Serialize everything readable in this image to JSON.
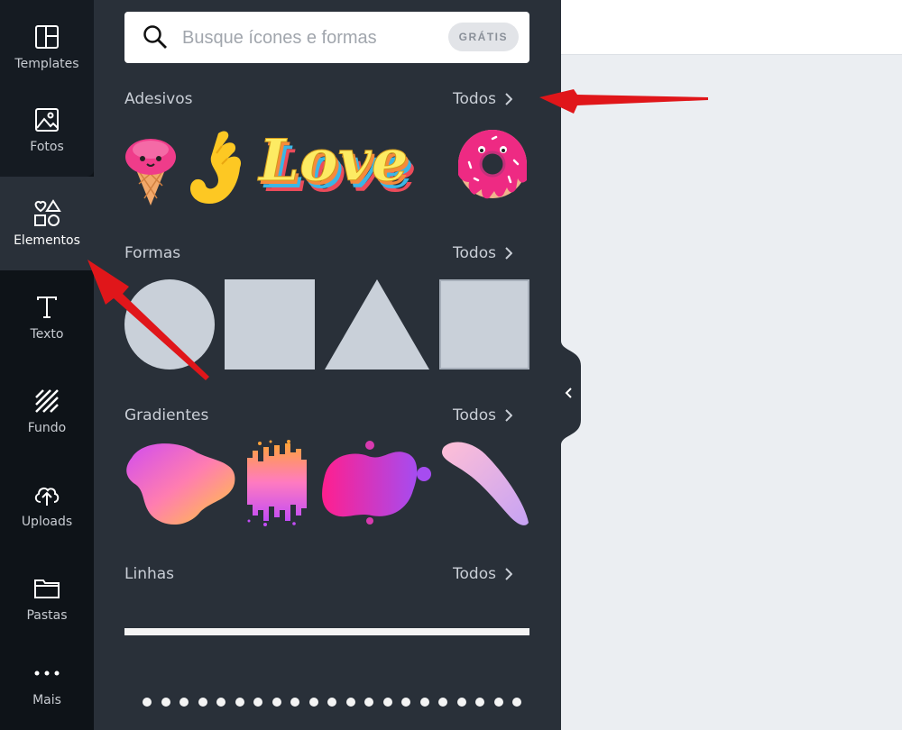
{
  "sidebar": {
    "items": [
      {
        "label": "Templates",
        "icon": "templates-icon"
      },
      {
        "label": "Fotos",
        "icon": "photos-icon"
      },
      {
        "label": "Elementos",
        "icon": "elements-icon",
        "active": true
      },
      {
        "label": "Texto",
        "icon": "text-icon"
      },
      {
        "label": "Fundo",
        "icon": "background-icon"
      },
      {
        "label": "Uploads",
        "icon": "upload-icon"
      },
      {
        "label": "Pastas",
        "icon": "folder-icon"
      },
      {
        "label": "Mais",
        "icon": "more-icon"
      }
    ]
  },
  "search": {
    "placeholder": "Busque ícones e formas",
    "badge": "GRÁTIS"
  },
  "sections": {
    "adesivos": {
      "title": "Adesivos",
      "all": "Todos"
    },
    "formas": {
      "title": "Formas",
      "all": "Todos"
    },
    "gradientes": {
      "title": "Gradientes",
      "all": "Todos"
    },
    "linhas": {
      "title": "Linhas",
      "all": "Todos"
    }
  },
  "stickers": {
    "love_text": "Love"
  },
  "colors": {
    "sidebar_bg": "#0e1318",
    "panel_bg": "#293039",
    "canvas_bg": "#ebeef2",
    "shape_fill": "#c9d0d9",
    "annotation_arrow": "#e0161a"
  }
}
